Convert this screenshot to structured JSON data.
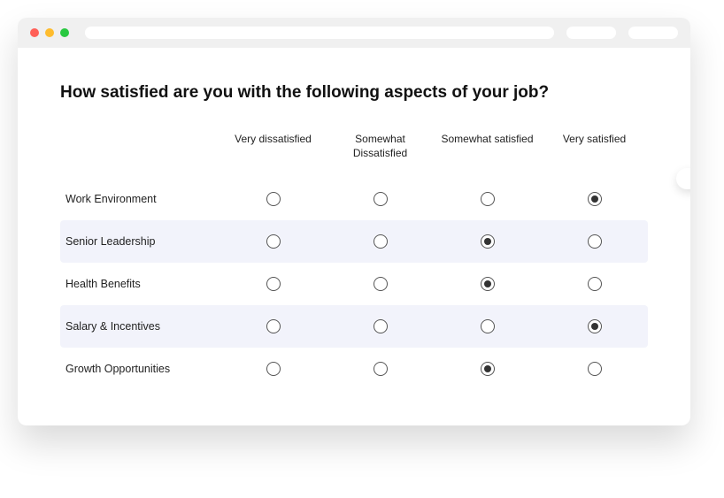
{
  "survey": {
    "question": "How satisfied are you with the following aspects of your job?",
    "columns": [
      "Very dissatisfied",
      "Somewhat Dissatisfied",
      "Somewhat satisfied",
      "Very satisfied"
    ],
    "rows": [
      {
        "label": "Work Environment",
        "selected": 3
      },
      {
        "label": "Senior Leadership",
        "selected": 2
      },
      {
        "label": "Health Benefits",
        "selected": 2
      },
      {
        "label": "Salary & Incentives",
        "selected": 3
      },
      {
        "label": "Growth Opportunities",
        "selected": 2
      }
    ]
  }
}
